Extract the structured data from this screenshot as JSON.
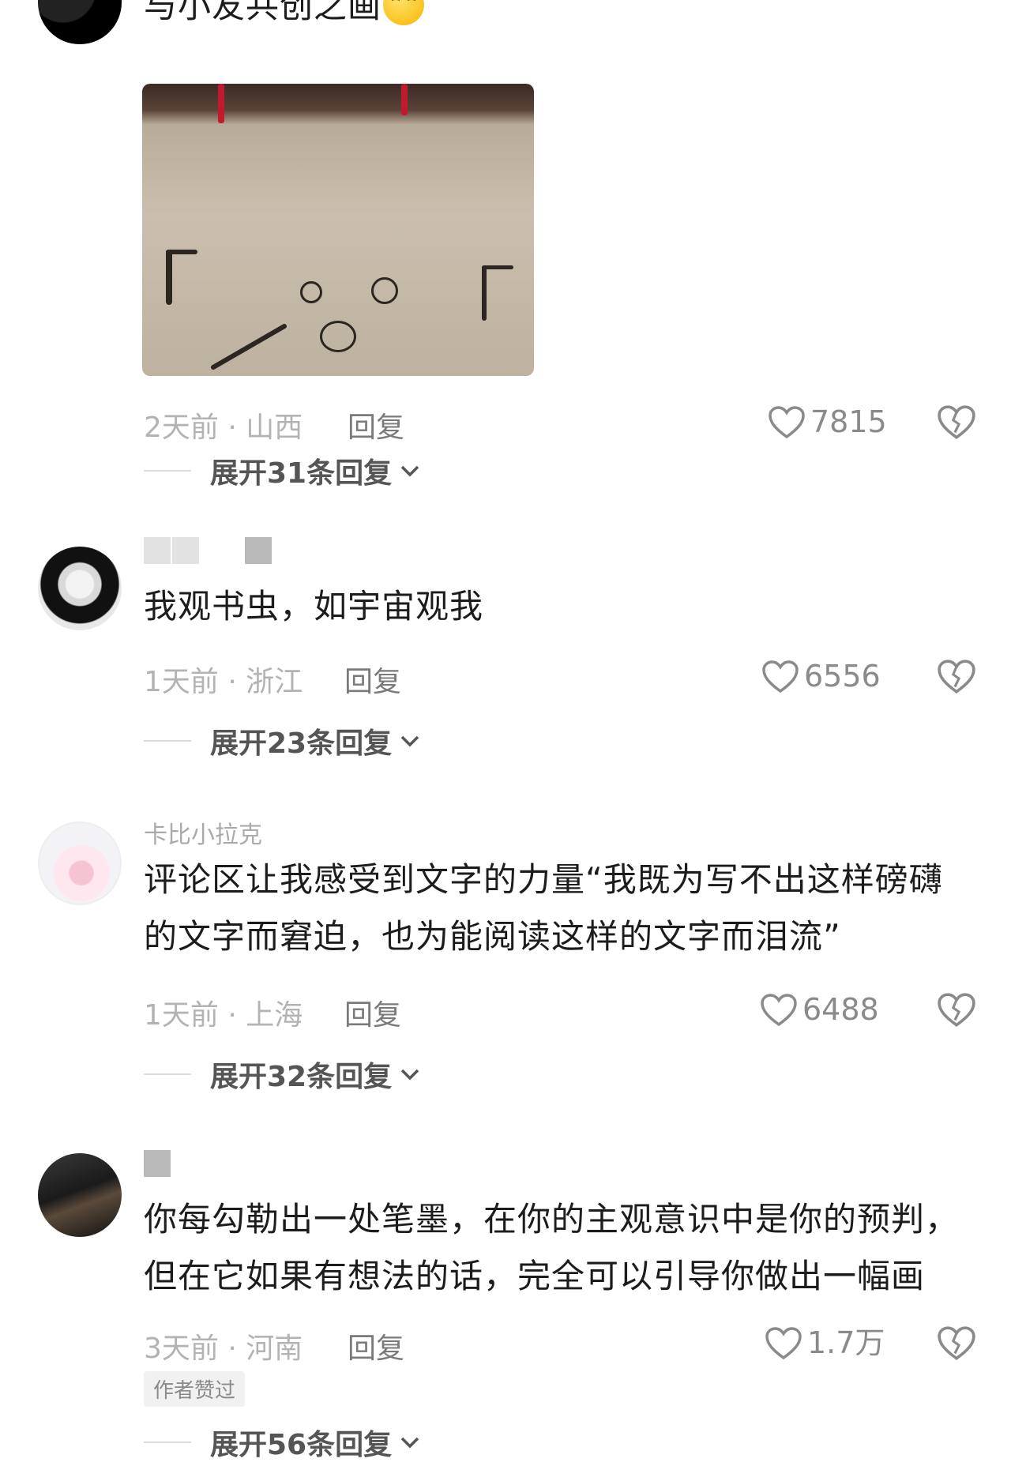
{
  "comments": [
    {
      "text": "与小友共创之画",
      "location": "2天前 · 山西",
      "reply_label": "回复",
      "likes": "7815",
      "expand_label": "展开31条回复"
    },
    {
      "text": "我观书虫，如宇宙观我",
      "location": "1天前 · 浙江",
      "reply_label": "回复",
      "likes": "6556",
      "expand_label": "展开23条回复"
    },
    {
      "name": "卡比小拉克",
      "text": "评论区让我感受到文字的力量“我既为写不出这样磅礴的文字而窘迫，也为能阅读这样的文字而泪流”",
      "location": "1天前 · 上海",
      "reply_label": "回复",
      "likes": "6488",
      "expand_label": "展开32条回复"
    },
    {
      "text": "你每勾勒出一处笔墨，在你的主观意识中是你的预判，但在它如果有想法的话，完全可以引导你做出一幅画",
      "location": "3天前 · 河南",
      "reply_label": "回复",
      "likes": "1.7万",
      "author_badge": "作者赞过",
      "expand_label": "展开56条回复"
    }
  ],
  "icons": {
    "like": "heart-outline-icon",
    "dislike": "broken-heart-icon",
    "expand": "chevron-down-icon",
    "emoji": "smiling-hug-emoji"
  }
}
